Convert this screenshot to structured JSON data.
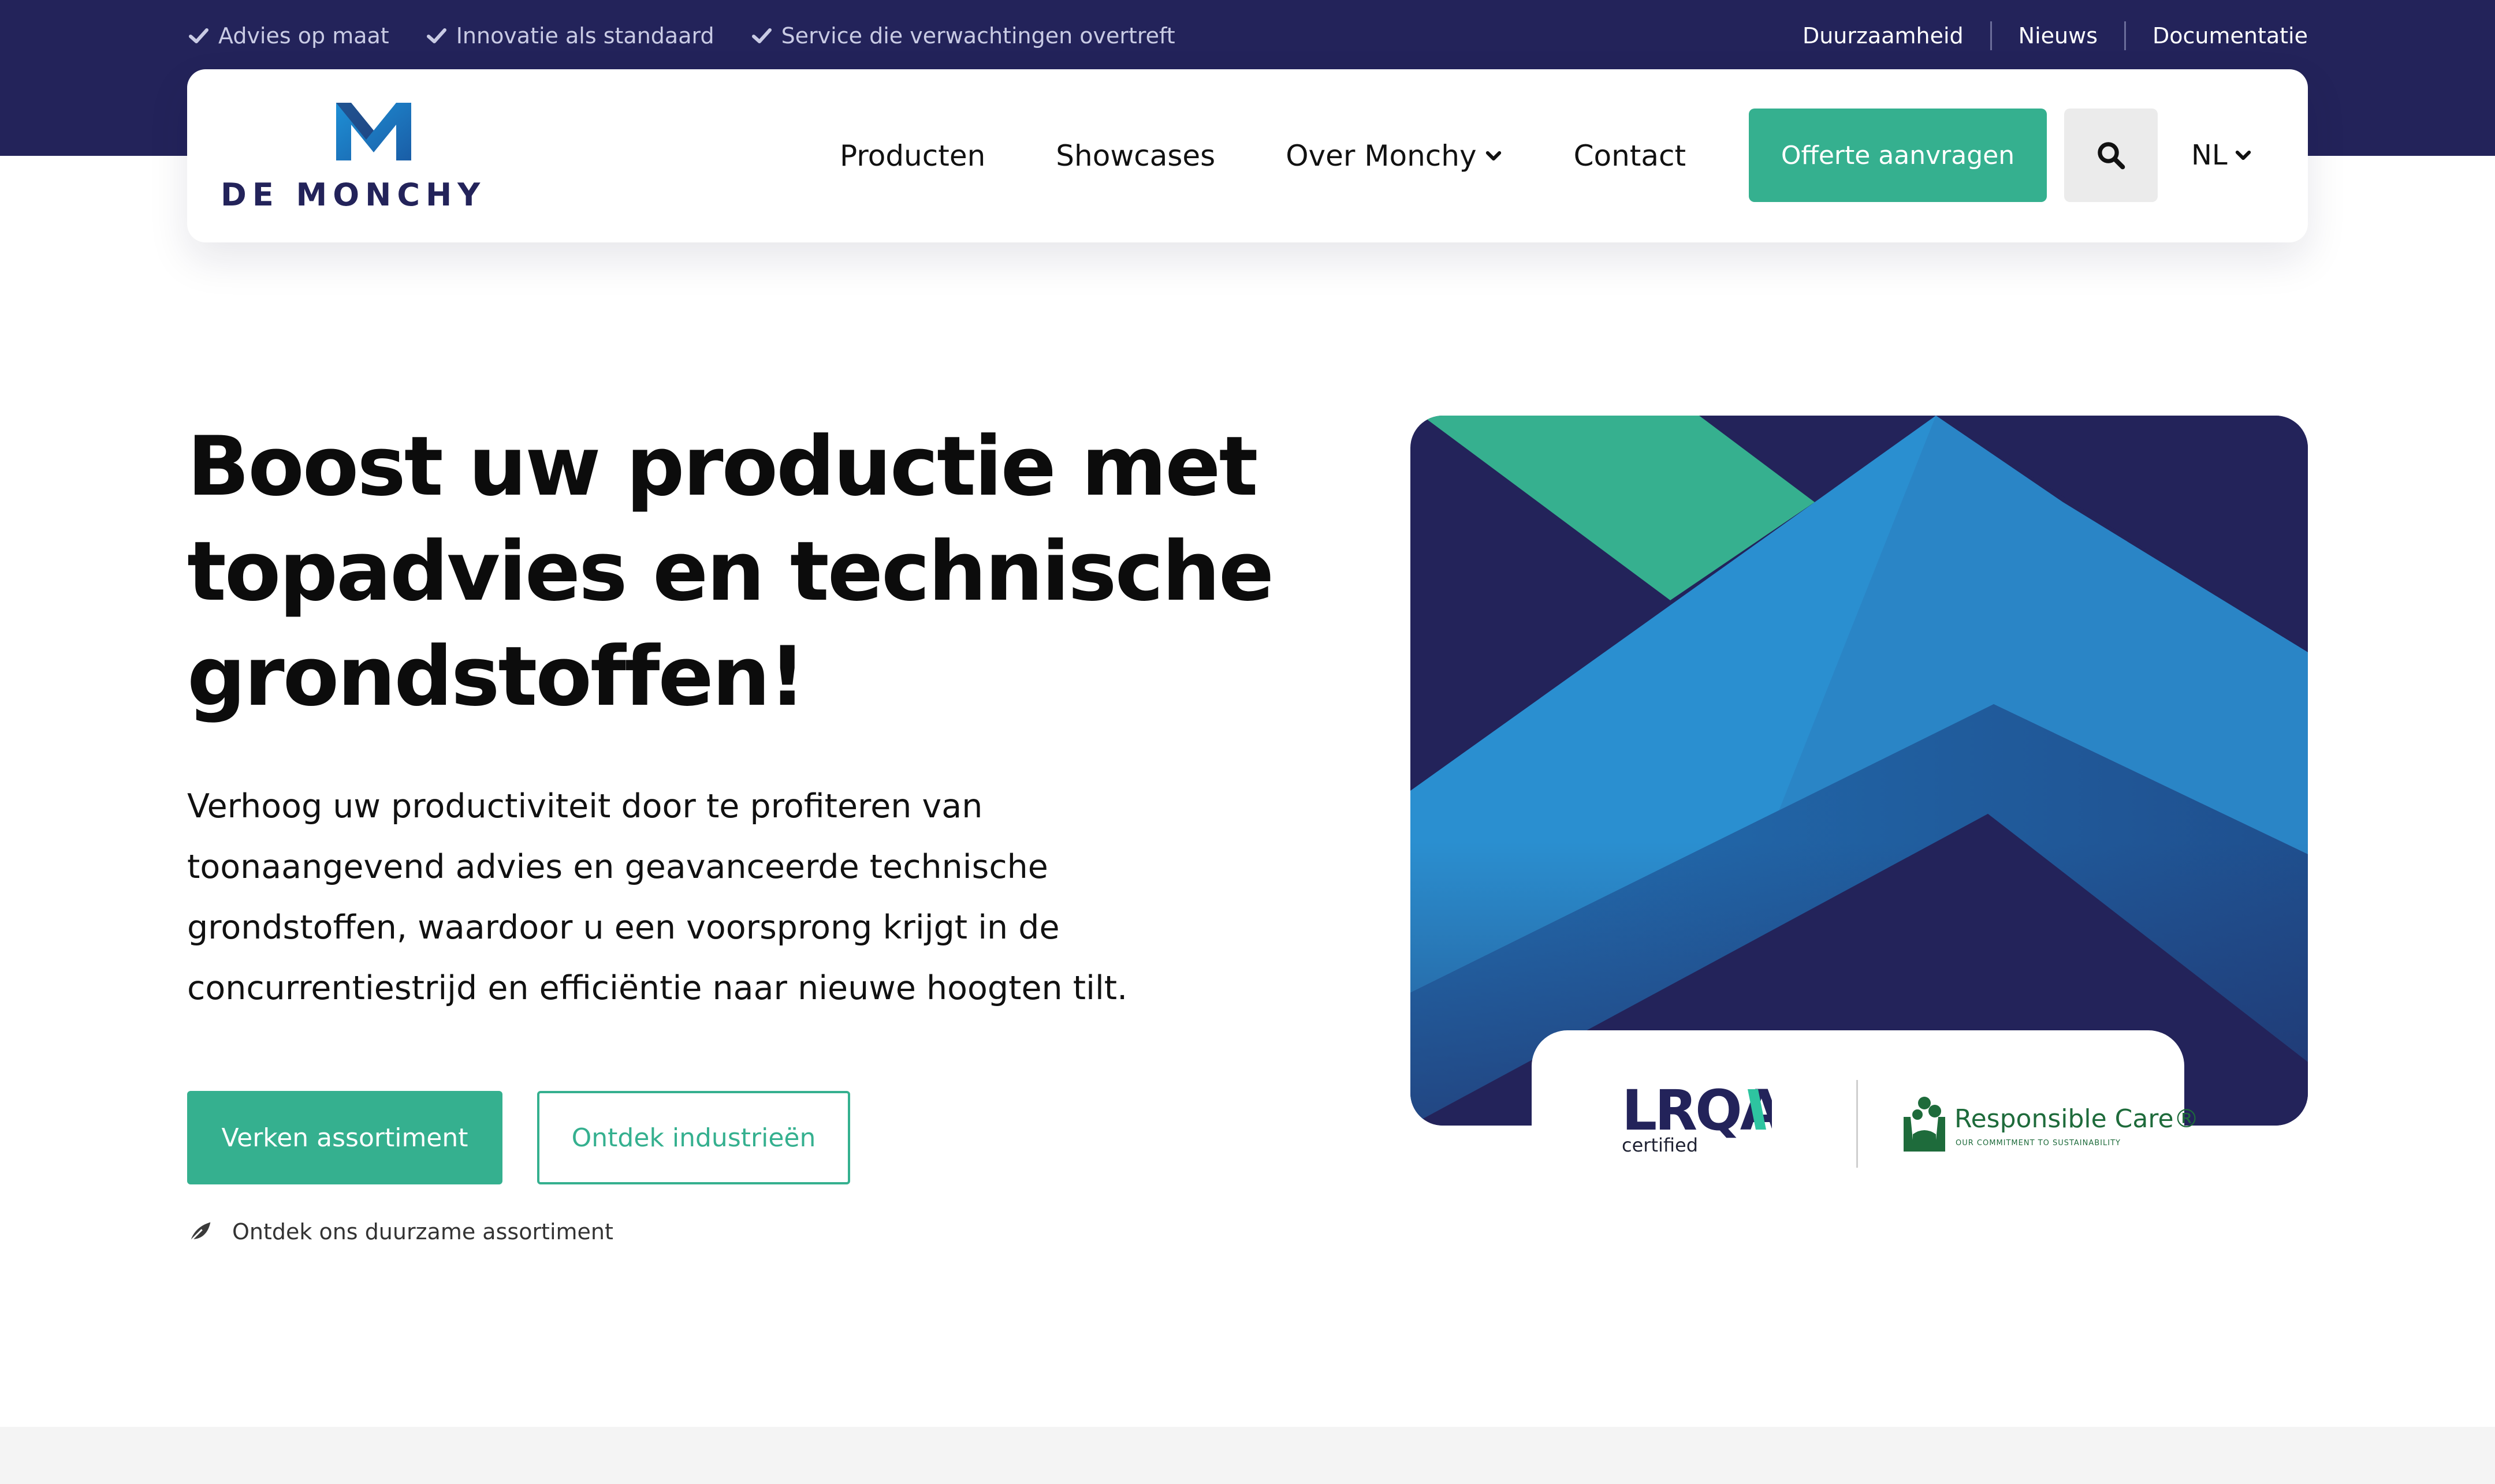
{
  "topbar": {
    "usps": [
      "Advies op maat",
      "Innovatie als standaard",
      "Service die verwachtingen overtreft"
    ],
    "links": [
      "Duurzaamheid",
      "Nieuws",
      "Documentatie"
    ]
  },
  "header": {
    "logo_text": "DE MONCHY",
    "menu": [
      "Producten",
      "Showcases",
      "Over Monchy",
      "Contact"
    ],
    "quote_label": "Offerte aanvragen",
    "language": "NL"
  },
  "hero": {
    "title": "Boost uw productie met topadvies en technische grondstoffen!",
    "text": "Verhoog uw productiviteit door te profiteren van toonaangevend advies en geavanceerde technische grondstoffen, waardoor u een voorsprong krijgt in de concurrentiestrijd en efficiëntie naar nieuwe hoogten tilt.",
    "primary_button": "Verken assortiment",
    "secondary_button": "Ontdek industrieën",
    "sustain_link": "Ontdek ons duurzame assortiment"
  },
  "certifications": {
    "lrqa_logo": "LRQA",
    "lrqa_sub": "certified",
    "rc_title": "Responsible Care®",
    "rc_sub": "OUR COMMITMENT TO SUSTAINABILITY"
  },
  "colors": {
    "navy": "#23235a",
    "green": "#35b08f",
    "blue": "#2a8fd0"
  },
  "icons": {
    "usp": "check-icon",
    "menu_dropdown": "chevron-down-icon",
    "search": "search-icon",
    "sustain": "leaf-icon"
  }
}
